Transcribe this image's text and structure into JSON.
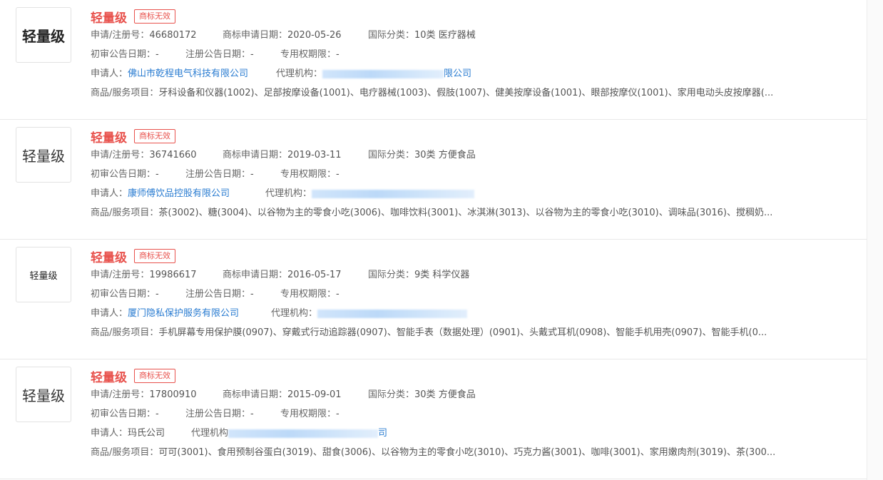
{
  "items": [
    {
      "logo_text": "轻量级",
      "name": "轻量级",
      "status": "商标无效",
      "reg_label": "申请/注册号：",
      "reg_no": "46680172",
      "date_label": "商标申请日期：",
      "apply_date": "2020-05-26",
      "class_label": "国际分类：",
      "class": "10类 医疗器械",
      "prelim_label": "初审公告日期：",
      "prelim": "-",
      "regpub_label": "注册公告日期：",
      "regpub": "-",
      "term_label": "专用权期限：",
      "term": "-",
      "applicant_label": "申请人：",
      "applicant": "佛山市乾程电气科技有限公司",
      "agent_label": "代理机构：",
      "agent": "限公司",
      "goods_label": "商品/服务项目：",
      "goods": "牙科设备和仪器(1002)、足部按摩设备(1001)、电疗器械(1003)、假肢(1007)、健美按摩设备(1001)、眼部按摩仪(1001)、家用电动头皮按摩器(..."
    },
    {
      "logo_text": "轻量级",
      "name": "轻量级",
      "status": "商标无效",
      "reg_label": "申请/注册号：",
      "reg_no": "36741660",
      "date_label": "商标申请日期：",
      "apply_date": "2019-03-11",
      "class_label": "国际分类：",
      "class": "30类 方便食品",
      "prelim_label": "初审公告日期：",
      "prelim": "-",
      "regpub_label": "注册公告日期：",
      "regpub": "-",
      "term_label": "专用权期限：",
      "term": "-",
      "applicant_label": "申请人：",
      "applicant": "康师傅饮品控股有限公司",
      "agent_label": "代理机构：",
      "agent": "",
      "goods_label": "商品/服务项目：",
      "goods": "茶(3002)、糖(3004)、以谷物为主的零食小吃(3006)、咖啡饮料(3001)、冰淇淋(3013)、以谷物为主的零食小吃(3010)、调味品(3016)、搅稠奶..."
    },
    {
      "logo_text": "轻量级",
      "name": "轻量级",
      "status": "商标无效",
      "reg_label": "申请/注册号：",
      "reg_no": "19986617",
      "date_label": "商标申请日期：",
      "apply_date": "2016-05-17",
      "class_label": "国际分类：",
      "class": "9类 科学仪器",
      "prelim_label": "初审公告日期：",
      "prelim": "-",
      "regpub_label": "注册公告日期：",
      "regpub": "-",
      "term_label": "专用权期限：",
      "term": "-",
      "applicant_label": "申请人：",
      "applicant": "厦门隐私保护服务有限公司",
      "agent_label": "代理机构：",
      "agent": "",
      "goods_label": "商品/服务项目：",
      "goods": "手机屏幕专用保护膜(0907)、穿戴式行动追踪器(0907)、智能手表（数据处理）(0901)、头戴式耳机(0908)、智能手机用壳(0907)、智能手机(0..."
    },
    {
      "logo_text": "轻量级",
      "name": "轻量级",
      "status": "商标无效",
      "reg_label": "申请/注册号：",
      "reg_no": "17800910",
      "date_label": "商标申请日期：",
      "apply_date": "2015-09-01",
      "class_label": "国际分类：",
      "class": "30类 方便食品",
      "prelim_label": "初审公告日期：",
      "prelim": "-",
      "regpub_label": "注册公告日期：",
      "regpub": "-",
      "term_label": "专用权期限：",
      "term": "-",
      "applicant_label": "申请人：",
      "applicant": "玛氏公司",
      "agent_label": "代理机构",
      "agent": "司",
      "goods_label": "商品/服务项目：",
      "goods": "可可(3001)、食用预制谷蛋白(3019)、甜食(3006)、以谷物为主的零食小吃(3010)、巧克力酱(3001)、咖啡(3001)、家用嫩肉剂(3019)、茶(300..."
    }
  ]
}
